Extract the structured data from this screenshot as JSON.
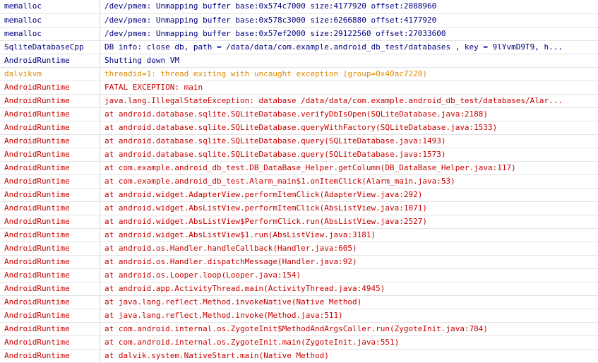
{
  "colors": {
    "debug": "#00007f",
    "warn": "#e08a00",
    "error": "#c80000",
    "grid": "#e4e4e4"
  },
  "rows": [
    {
      "level": "D",
      "tag": "memalloc",
      "text": "/dev/pmem: Unmapping buffer base:0x574c7000 size:4177920 offset:2088960"
    },
    {
      "level": "D",
      "tag": "memalloc",
      "text": "/dev/pmem: Unmapping buffer base:0x578c3000 size:6266880 offset:4177920"
    },
    {
      "level": "D",
      "tag": "memalloc",
      "text": "/dev/pmem: Unmapping buffer base:0x57ef2000 size:29122560 offset:27033600"
    },
    {
      "level": "D",
      "tag": "SqliteDatabaseCpp",
      "text": "DB info: close db, path = /data/data/com.example.android_db_test/databases , key = 9lYvmD9T9, h..."
    },
    {
      "level": "D",
      "tag": "AndroidRuntime",
      "text": "Shutting down VM"
    },
    {
      "level": "W",
      "tag": "dalvikvm",
      "text": "threadid=1: thread exiting with uncaught exception (group=0x40ac7228)"
    },
    {
      "level": "E",
      "tag": "AndroidRuntime",
      "text": "FATAL EXCEPTION: main"
    },
    {
      "level": "E",
      "tag": "AndroidRuntime",
      "text": "java.lang.IllegalStateException: database /data/data/com.example.android_db_test/databases/Alar..."
    },
    {
      "level": "E",
      "tag": "AndroidRuntime",
      "text": "at android.database.sqlite.SQLiteDatabase.verifyDbIsOpen(SQLiteDatabase.java:2188)"
    },
    {
      "level": "E",
      "tag": "AndroidRuntime",
      "text": "at android.database.sqlite.SQLiteDatabase.queryWithFactory(SQLiteDatabase.java:1533)"
    },
    {
      "level": "E",
      "tag": "AndroidRuntime",
      "text": "at android.database.sqlite.SQLiteDatabase.query(SQLiteDatabase.java:1493)"
    },
    {
      "level": "E",
      "tag": "AndroidRuntime",
      "text": "at android.database.sqlite.SQLiteDatabase.query(SQLiteDatabase.java:1573)"
    },
    {
      "level": "E",
      "tag": "AndroidRuntime",
      "text": "at com.example.android_db_test.DB_DataBase_Helper.getColumn(DB_DataBase_Helper.java:117)"
    },
    {
      "level": "E",
      "tag": "AndroidRuntime",
      "text": "at com.example.android_db_test.Alarm_main$1.onItemClick(Alarm_main.java:53)"
    },
    {
      "level": "E",
      "tag": "AndroidRuntime",
      "text": "at android.widget.AdapterView.performItemClick(AdapterView.java:292)"
    },
    {
      "level": "E",
      "tag": "AndroidRuntime",
      "text": "at android.widget.AbsListView.performItemClick(AbsListView.java:1071)"
    },
    {
      "level": "E",
      "tag": "AndroidRuntime",
      "text": "at android.widget.AbsListView$PerformClick.run(AbsListView.java:2527)"
    },
    {
      "level": "E",
      "tag": "AndroidRuntime",
      "text": "at android.widget.AbsListView$1.run(AbsListView.java:3181)"
    },
    {
      "level": "E",
      "tag": "AndroidRuntime",
      "text": "at android.os.Handler.handleCallback(Handler.java:605)"
    },
    {
      "level": "E",
      "tag": "AndroidRuntime",
      "text": "at android.os.Handler.dispatchMessage(Handler.java:92)"
    },
    {
      "level": "E",
      "tag": "AndroidRuntime",
      "text": "at android.os.Looper.loop(Looper.java:154)"
    },
    {
      "level": "E",
      "tag": "AndroidRuntime",
      "text": "at android.app.ActivityThread.main(ActivityThread.java:4945)"
    },
    {
      "level": "E",
      "tag": "AndroidRuntime",
      "text": "at java.lang.reflect.Method.invokeNative(Native Method)"
    },
    {
      "level": "E",
      "tag": "AndroidRuntime",
      "text": "at java.lang.reflect.Method.invoke(Method.java:511)"
    },
    {
      "level": "E",
      "tag": "AndroidRuntime",
      "text": "at com.android.internal.os.ZygoteInit$MethodAndArgsCaller.run(ZygoteInit.java:784)"
    },
    {
      "level": "E",
      "tag": "AndroidRuntime",
      "text": "at com.android.internal.os.ZygoteInit.main(ZygoteInit.java:551)"
    },
    {
      "level": "E",
      "tag": "AndroidRuntime",
      "text": "at dalvik.system.NativeStart.main(Native Method)"
    }
  ]
}
